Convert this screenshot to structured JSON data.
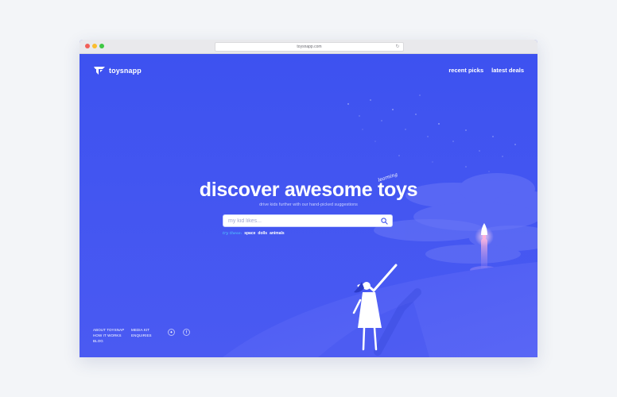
{
  "browser": {
    "url": "toysnapp.com"
  },
  "header": {
    "brand": "toysnapp",
    "nav": [
      {
        "label": "recent picks"
      },
      {
        "label": "latest deals"
      }
    ]
  },
  "hero": {
    "title": "discover awesome toys",
    "tag": "learning",
    "subtitle": "drive kids further with our hand-picked suggestions"
  },
  "search": {
    "placeholder": "my kid likes...",
    "try_label": "try these:",
    "suggestions": [
      "space",
      "dolls",
      "animals"
    ]
  },
  "footer": {
    "links": [
      "ABOUT TOYSNAP",
      "MEDIA KIT",
      "HOW IT WORKS",
      "ENQUIRIES",
      "BLOG"
    ],
    "social": [
      {
        "icon": "twitter-icon",
        "glyph": "✦"
      },
      {
        "icon": "facebook-icon",
        "glyph": "f"
      }
    ]
  },
  "colors": {
    "brand_blue": "#3d52f0",
    "accent_cyan": "#53d3ff",
    "white": "#ffffff"
  }
}
